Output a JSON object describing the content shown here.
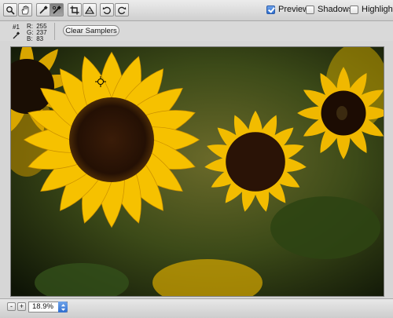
{
  "toolbar": {
    "tools": [
      {
        "name": "zoom-tool",
        "icon": "magnifier-icon",
        "active": false
      },
      {
        "name": "hand-tool",
        "icon": "hand-icon",
        "active": false
      },
      {
        "name": "white-balance-tool",
        "icon": "eyedropper-icon",
        "active": false
      },
      {
        "name": "color-sampler-tool",
        "icon": "color-sampler-icon",
        "active": true
      },
      {
        "name": "crop-tool",
        "icon": "crop-icon",
        "active": false
      },
      {
        "name": "straighten-tool",
        "icon": "straighten-icon",
        "active": false
      },
      {
        "name": "rotate-left-tool",
        "icon": "rotate-ccw-icon",
        "active": false
      },
      {
        "name": "rotate-right-tool",
        "icon": "rotate-cw-icon",
        "active": false
      }
    ],
    "preview": {
      "label": "Preview",
      "checked": true
    },
    "shadows": {
      "label": "Shadows",
      "checked": false
    },
    "highlights": {
      "label": "Highlights",
      "checked": false
    }
  },
  "sampler": {
    "number": "#1",
    "r_label": "R:",
    "r_value": "255",
    "g_label": "G:",
    "g_value": "237",
    "b_label": "B:",
    "b_value": "83"
  },
  "clear_samplers_label": "Clear Samplers",
  "zoom": {
    "minus": "-",
    "plus": "+",
    "value": "18.9%"
  },
  "colors": {
    "petal": "#f2bc00",
    "disk": "#2a1306",
    "leaf": "#3f5a1c",
    "accent": "#2f6fcf"
  }
}
